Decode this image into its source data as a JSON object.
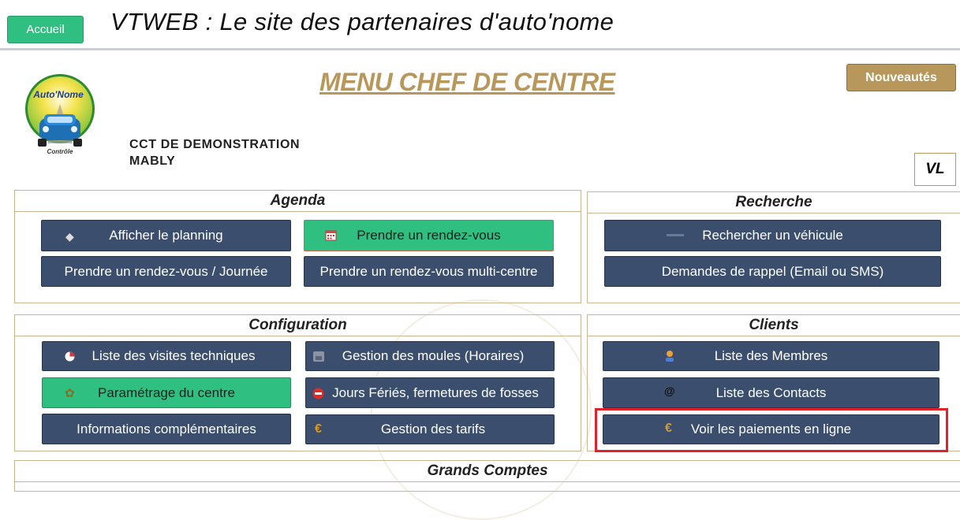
{
  "header": {
    "home_label": "Accueil",
    "site_title": "VTWEB : Le site des partenaires d'auto'nome",
    "menu_title": "MENU CHEF DE CENTRE",
    "news_label": "Nouveautés",
    "logo_text_top": "Auto'Nome",
    "logo_text_bottom": "Contrôle",
    "centre_name": "CCT DE DEMONSTRATION",
    "centre_city": "MABLY",
    "vehicle_type": "VL"
  },
  "agenda": {
    "title": "Agenda",
    "buttons": [
      "Afficher le planning",
      "Prendre un rendez-vous",
      "Prendre un rendez-vous / Journée",
      "Prendre un rendez-vous multi-centre"
    ]
  },
  "recherche": {
    "title": "Recherche",
    "buttons": [
      "Rechercher un véhicule",
      "Demandes de rappel (Email ou SMS)"
    ]
  },
  "configuration": {
    "title": "Configuration",
    "buttons": [
      "Liste des visites techniques",
      "Gestion des moules (Horaires)",
      "Paramétrage du centre",
      "Jours Fériés, fermetures de fosses",
      "Informations complémentaires",
      "Gestion des tarifs"
    ]
  },
  "clients": {
    "title": "Clients",
    "buttons": [
      "Liste des Membres",
      "Liste des Contacts",
      "Voir les paiements en ligne"
    ]
  },
  "grands_comptes": {
    "title": "Grands Comptes"
  },
  "icons": {
    "euro": "€",
    "at": "@"
  },
  "colors": {
    "navy_button": "#3b4e6d",
    "green_button": "#2fbf80",
    "gold": "#b8975a",
    "highlight": "#e0222a"
  }
}
